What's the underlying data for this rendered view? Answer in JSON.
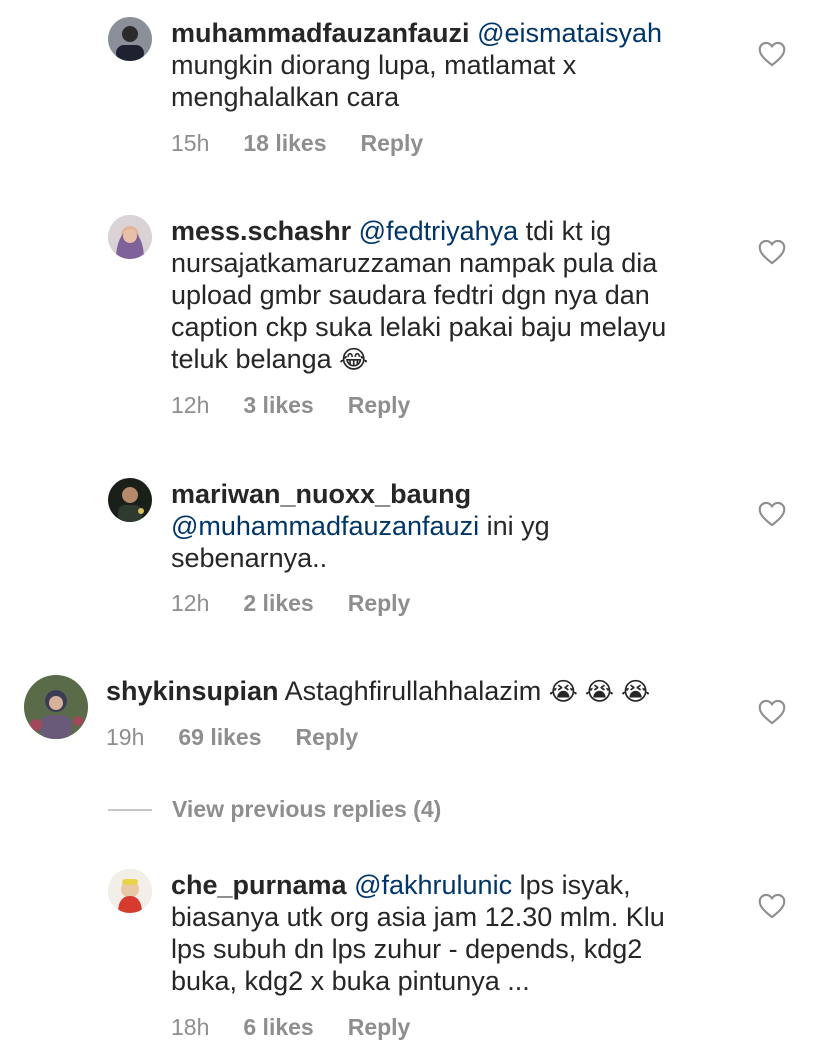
{
  "comments": [
    {
      "username": "muhammadfauzanfauzi",
      "mention": "@eismataisyah",
      "text_line1": "",
      "text_rest": "mungkin diorang lupa, matlamat x",
      "text_line3": "menghalalkan cara",
      "time": "15h",
      "likes": "18 likes",
      "reply": "Reply",
      "avatar_icon": "avatar-icon",
      "heart_icon": "heart-outline-icon"
    },
    {
      "username": "mess.schashr",
      "mention": "@fedtriyahya",
      "text_line1": "tdi kt ig",
      "text_line2": "nursajatkamaruzzaman nampak pula dia",
      "text_line3": "upload gmbr saudara fedtri dgn nya dan",
      "text_line4": "caption ckp suka lelaki pakai baju melayu",
      "text_line5": "teluk belanga",
      "emoji": "😂",
      "time": "12h",
      "likes": "3 likes",
      "reply": "Reply"
    },
    {
      "username": "mariwan_nuoxx_baung",
      "mention": "@muhammadfauzanfauzi",
      "text_line2": "ini yg",
      "text_line3": "sebenarnya..",
      "time": "12h",
      "likes": "2 likes",
      "reply": "Reply"
    },
    {
      "username": "shykinsupian",
      "text": "Astaghfirullahhalazim",
      "emoji": "😭 😭 😭",
      "time": "19h",
      "likes": "69 likes",
      "reply": "Reply"
    },
    {
      "username": "che_purnama",
      "mention": "@fakhrulunic",
      "text_line1": "lps isyak,",
      "text_line2": "biasanya utk org asia jam 12.30 mlm. Klu",
      "text_line3": "lps subuh dn lps zuhur - depends, kdg2",
      "text_line4": "buka, kdg2 x buka pintunya ...",
      "time": "18h",
      "likes": "6 likes",
      "reply": "Reply"
    }
  ],
  "view_previous": "View previous replies (4)",
  "colors": {
    "mention": "#003569",
    "meta": "#8e8e8e",
    "text": "#262626"
  }
}
